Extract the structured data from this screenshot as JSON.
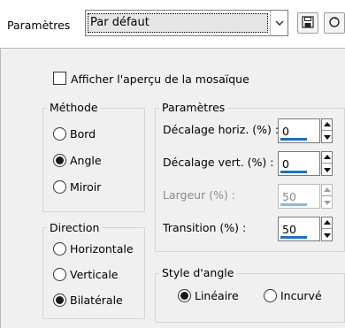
{
  "toolbar": {
    "preset_label": "Paramètres",
    "preset_value": "Par défaut",
    "save_icon": "save-icon",
    "reset_icon": "reset-icon"
  },
  "preview": {
    "label": "Afficher l'aperçu de la mosaïque",
    "checked": false
  },
  "method": {
    "title": "Méthode",
    "options": [
      "Bord",
      "Angle",
      "Miroir"
    ],
    "selected": "Angle"
  },
  "direction": {
    "title": "Direction",
    "options": [
      "Horizontale",
      "Verticale",
      "Bilatérale"
    ],
    "selected": "Bilatérale"
  },
  "params": {
    "title": "Paramètres",
    "fields": [
      {
        "label": "Décalage horiz. (%) :",
        "value": "0",
        "enabled": true
      },
      {
        "label": "Décalage vert. (%) :",
        "value": "0",
        "enabled": true
      },
      {
        "label": "Largeur (%) :",
        "value": "50",
        "enabled": false
      },
      {
        "label": "Transition (%) :",
        "value": "50",
        "enabled": true
      }
    ]
  },
  "corner_style": {
    "title": "Style d'angle",
    "options": [
      "Linéaire",
      "Incurvé"
    ],
    "selected": "Linéaire"
  }
}
